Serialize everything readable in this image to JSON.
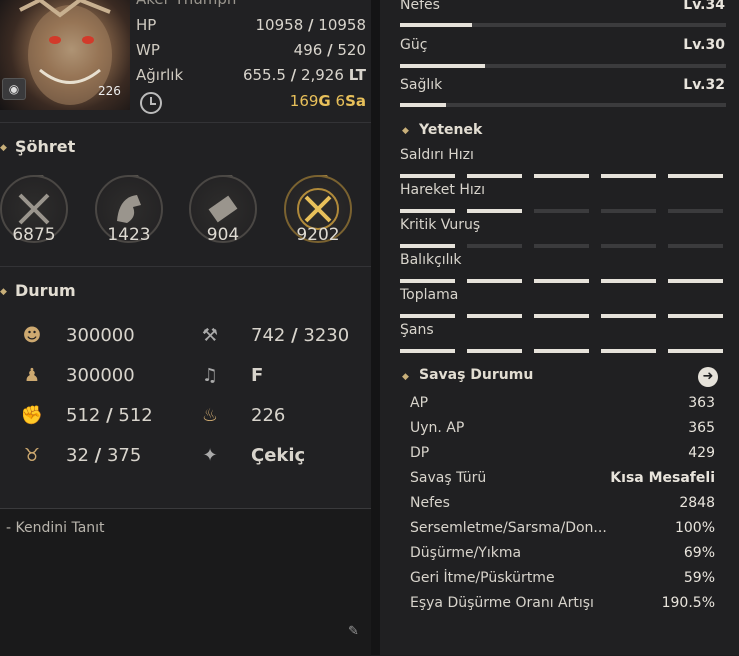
{
  "profile": {
    "name": "Aker Thumph",
    "portrait_number": "226",
    "hp_label": "HP",
    "hp_current": "10958",
    "hp_max": "10958",
    "wp_label": "WP",
    "wp_current": "496",
    "wp_max": "520",
    "weight_label": "Ağırlık",
    "weight_current": "655.5",
    "weight_max": "2,926",
    "weight_unit": "LT",
    "time_g": "169",
    "time_g_unit": "G",
    "time_s": "6",
    "time_s_unit": "Sa",
    "slash": "/"
  },
  "fame": {
    "title": "Şöhret",
    "items": [
      {
        "value": "6875"
      },
      {
        "value": "1423"
      },
      {
        "value": "904"
      },
      {
        "value": "9202"
      }
    ]
  },
  "status": {
    "title": "Durum",
    "left": [
      {
        "value": "300000"
      },
      {
        "value": "300000"
      },
      {
        "current": "512",
        "max": "512"
      },
      {
        "current": "32",
        "max": "375"
      }
    ],
    "right": [
      {
        "current": "742",
        "max": "3230"
      },
      {
        "value": "F"
      },
      {
        "value": "226"
      },
      {
        "value": "Çekiç"
      }
    ]
  },
  "intro": {
    "label": "- Kendini Tanıt"
  },
  "life": {
    "items": [
      {
        "label": "Nefes",
        "level": "Lv.34",
        "progress": 0.22
      },
      {
        "label": "Güç",
        "level": "Lv.30",
        "progress": 0.26
      },
      {
        "label": "Sağlık",
        "level": "Lv.32",
        "progress": 0.14
      }
    ]
  },
  "talent": {
    "title": "Yetenek",
    "items": [
      {
        "label": "Saldırı Hızı",
        "filled": 5
      },
      {
        "label": "Hareket Hızı",
        "filled": 2
      },
      {
        "label": "Kritik Vuruş",
        "filled": 1
      },
      {
        "label": "Balıkçılık",
        "filled": 5
      },
      {
        "label": "Toplama",
        "filled": 5
      },
      {
        "label": "Şans",
        "filled": 5
      }
    ]
  },
  "combat": {
    "title": "Savaş Durumu",
    "rows": [
      {
        "label": "AP",
        "value": "363"
      },
      {
        "label": "Uyn. AP",
        "value": "365"
      },
      {
        "label": "DP",
        "value": "429"
      },
      {
        "label": "Savaş Türü",
        "value": "Kısa Mesafeli"
      },
      {
        "label": "Nefes",
        "value": "2848"
      },
      {
        "label": "Sersemletme/Sarsma/Don...",
        "value": "100%"
      },
      {
        "label": "Düşürme/Yıkma",
        "value": "69%"
      },
      {
        "label": "Geri İtme/Püskürtme",
        "value": "59%"
      },
      {
        "label": "Eşya Düşürme Oranı Artışı",
        "value": "190.5%"
      }
    ]
  },
  "colors": {
    "accent_gold": "#e8c05a",
    "bar_fill": "#e6e2da"
  }
}
